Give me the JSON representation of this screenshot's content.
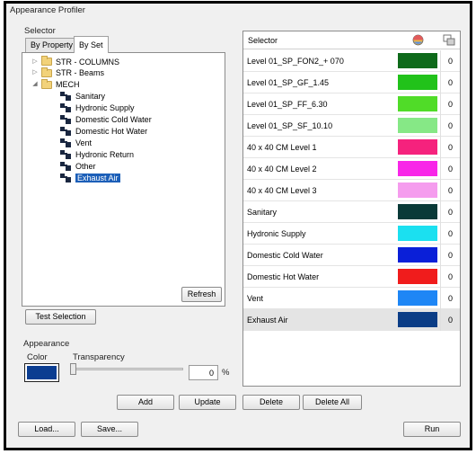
{
  "window": {
    "title": "Appearance Profiler"
  },
  "selector_group": {
    "label": "Selector",
    "tabs": [
      {
        "label": "By Property",
        "active": false
      },
      {
        "label": "By Set",
        "active": true
      }
    ],
    "tree": [
      {
        "label": "STR - COLUMNS",
        "type": "folder"
      },
      {
        "label": "STR - Beams",
        "type": "folder"
      },
      {
        "label": "MECH",
        "type": "folder",
        "expanded": true
      },
      {
        "label": "Sanitary",
        "type": "set"
      },
      {
        "label": "Hydronic Supply",
        "type": "set"
      },
      {
        "label": "Domestic Cold Water",
        "type": "set"
      },
      {
        "label": "Domestic Hot Water",
        "type": "set"
      },
      {
        "label": "Vent",
        "type": "set"
      },
      {
        "label": "Hydronic Return",
        "type": "set"
      },
      {
        "label": "Other",
        "type": "set"
      },
      {
        "label": "Exhaust Air",
        "type": "set",
        "selected": true
      }
    ],
    "refresh_label": "Refresh"
  },
  "test_selection_label": "Test Selection",
  "appearance": {
    "label": "Appearance",
    "color_label": "Color",
    "color": "#0b3d91",
    "transparency_label": "Transparency",
    "transparency_value": "0",
    "percent_label": "%"
  },
  "grid": {
    "header_label": "Selector",
    "rows": [
      {
        "name": "Level 01_SP_FON2_+ 070",
        "color": "#0e6a1a",
        "transparency": "0"
      },
      {
        "name": "Level 01_SP_GF_1.45",
        "color": "#21c21a",
        "transparency": "0"
      },
      {
        "name": "Level 01_SP_FF_6.30",
        "color": "#50dc28",
        "transparency": "0"
      },
      {
        "name": "Level 01_SP_SF_10.10",
        "color": "#86e886",
        "transparency": "0"
      },
      {
        "name": "40 x 40 CM Level 1",
        "color": "#f5227d",
        "transparency": "0"
      },
      {
        "name": "40 x 40 CM Level 2",
        "color": "#f826e8",
        "transparency": "0"
      },
      {
        "name": "40 x 40 CM Level 3",
        "color": "#f59cee",
        "transparency": "0"
      },
      {
        "name": "Sanitary",
        "color": "#0a3a38",
        "transparency": "0"
      },
      {
        "name": "Hydronic Supply",
        "color": "#1be0f0",
        "transparency": "0"
      },
      {
        "name": "Domestic Cold Water",
        "color": "#0a1fd8",
        "transparency": "0"
      },
      {
        "name": "Domestic Hot Water",
        "color": "#f01c1c",
        "transparency": "0"
      },
      {
        "name": "Vent",
        "color": "#1e86f5",
        "transparency": "0"
      },
      {
        "name": "Exhaust Air",
        "color": "#0b3d86",
        "transparency": "0",
        "selected": true
      }
    ]
  },
  "buttons": {
    "add": "Add",
    "update": "Update",
    "delete": "Delete",
    "delete_all": "Delete All",
    "load": "Load...",
    "save": "Save...",
    "run": "Run"
  }
}
